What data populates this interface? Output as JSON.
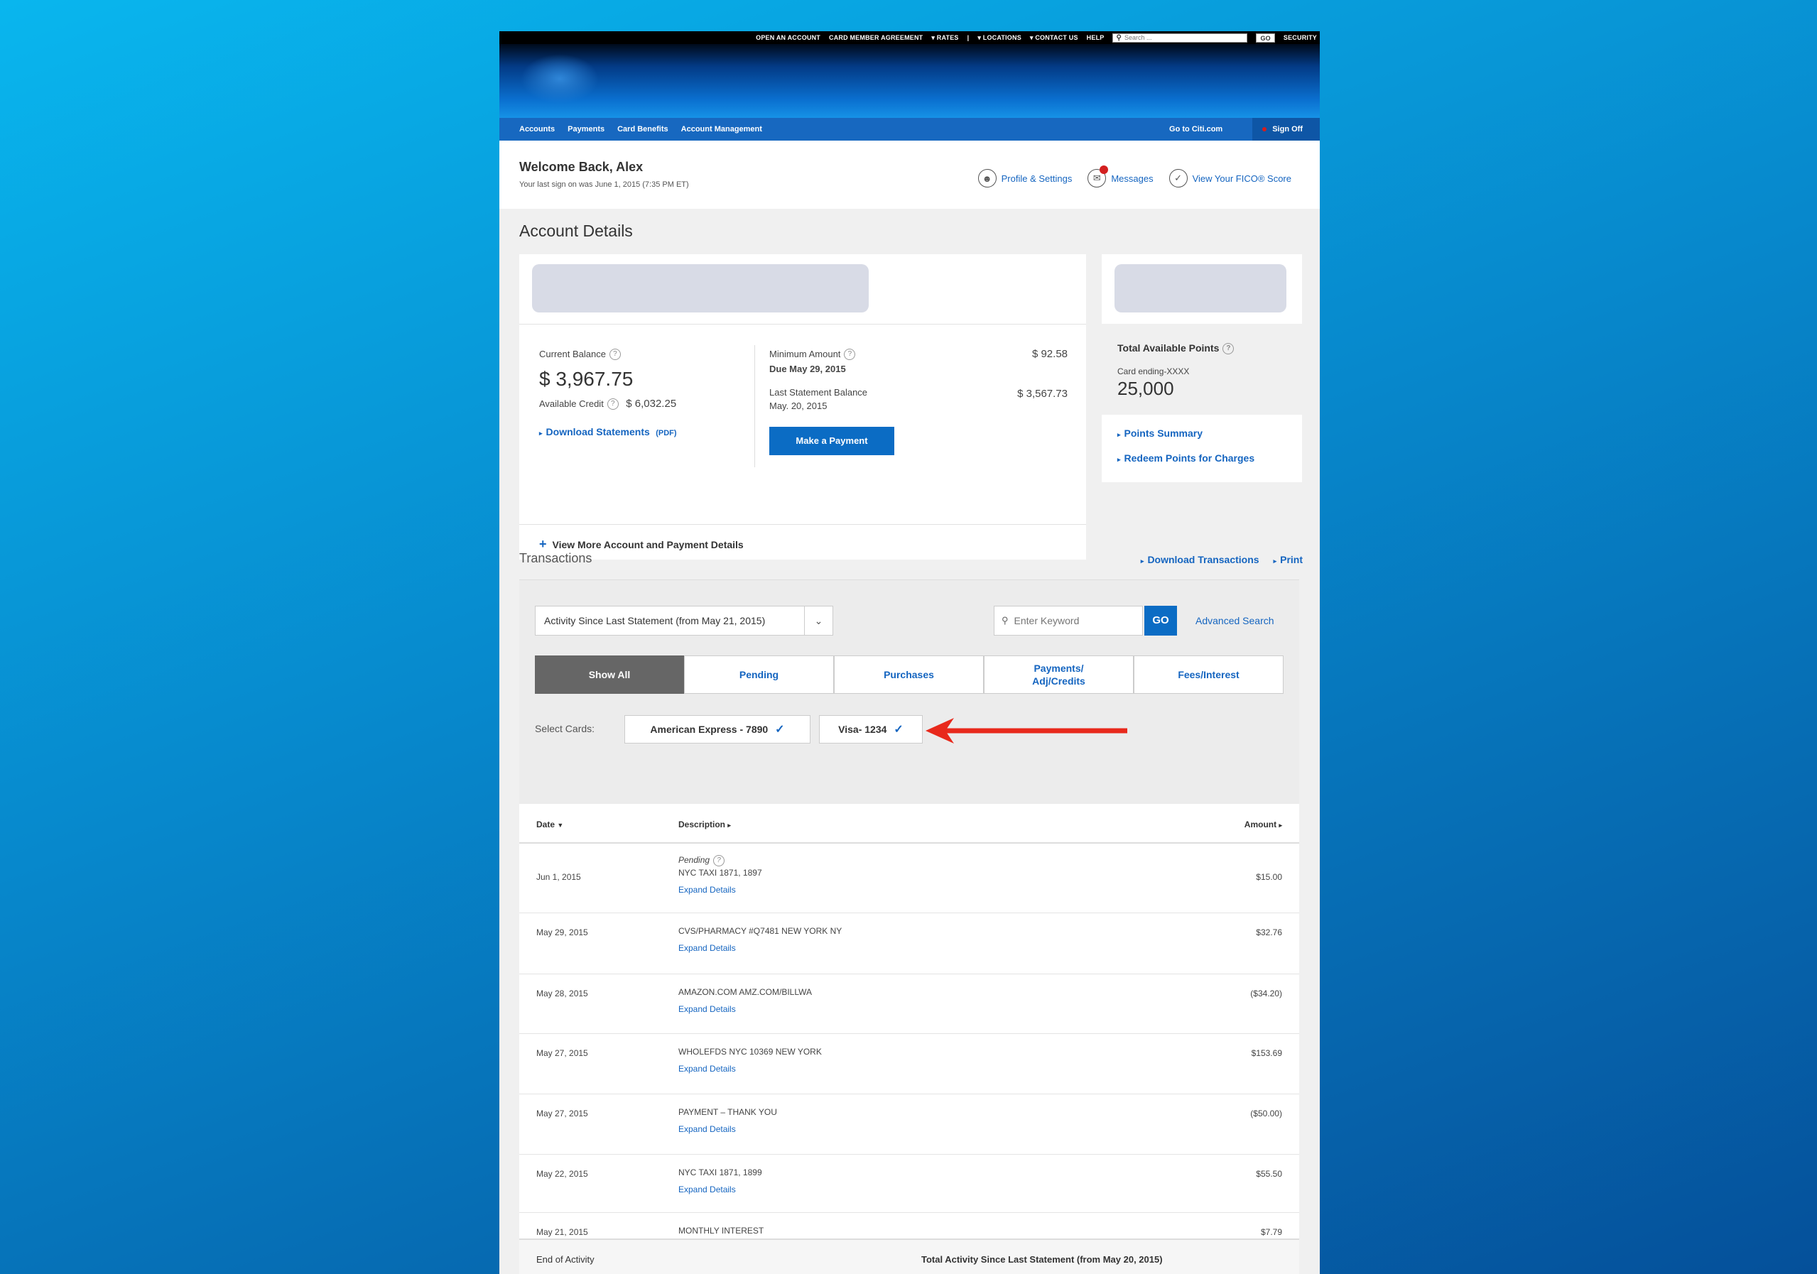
{
  "util_nav": {
    "items": [
      "OPEN AN ACCOUNT",
      "CARD MEMBER AGREEMENT",
      "▾ RATES",
      "|",
      "▾ LOCATIONS",
      "▾ CONTACT US",
      "HELP"
    ],
    "search_placeholder": "Search ...",
    "go": "GO",
    "security": "SECURITY"
  },
  "main_nav": {
    "items": [
      "Accounts",
      "Payments",
      "Card Benefits",
      "Account Management"
    ],
    "go_to": "Go to Citi.com",
    "sign_off": "Sign Off"
  },
  "welcome": {
    "greeting": "Welcome Back, Alex",
    "last_sign_on": "Your last sign on was June 1, 2015 (7:35 PM ET)"
  },
  "quick_links": {
    "profile": "Profile & Settings",
    "messages": "Messages",
    "fico": "View Your FICO® Score"
  },
  "account": {
    "section_title": "Account Details",
    "current_balance_label": "Current Balance",
    "current_balance": "$ 3,967.75",
    "available_credit_label": "Available Credit",
    "available_credit": "$ 6,032.25",
    "download_statements": "Download Statements",
    "pdf": "(PDF)",
    "minimum_amount_label": "Minimum Amount",
    "due_date": "Due May 29, 2015",
    "minimum_amount": "$ 92.58",
    "last_statement_label": "Last Statement Balance",
    "last_statement_date": "May. 20, 2015",
    "last_statement_balance": "$ 3,567.73",
    "make_payment": "Make a Payment",
    "view_more": "View More Account and Payment Details"
  },
  "points": {
    "title": "Total Available Points",
    "card_ending": "Card ending-XXXX",
    "value": "25,000",
    "summary_link": "Points Summary",
    "redeem_link": "Redeem Points for Charges"
  },
  "transactions": {
    "title": "Transactions",
    "download": "Download Transactions",
    "print": "Print",
    "period_select": "Activity Since Last Statement (from May 21, 2015)",
    "keyword_placeholder": "Enter Keyword",
    "go": "GO",
    "advanced_search": "Advanced Search",
    "tabs": [
      "Show All",
      "Pending",
      "Purchases",
      "Payments/\nAdj/Credits",
      "Fees/Interest"
    ],
    "select_cards_label": "Select Cards:",
    "cards": [
      "American Express - 7890",
      "Visa- 1234"
    ],
    "columns": {
      "date": "Date",
      "description": "Description",
      "amount": "Amount"
    },
    "expand_label": "Expand Details",
    "pending_label": "Pending",
    "rows": [
      {
        "date": "Jun 1, 2015",
        "description": "NYC TAXI 1871, 1897",
        "amount": "$15.00"
      },
      {
        "date": "May 29, 2015",
        "description": "CVS/PHARMACY #Q7481 NEW YORK NY",
        "amount": "$32.76"
      },
      {
        "date": "May 28, 2015",
        "description": "AMAZON.COM AMZ.COM/BILLWA",
        "amount": "($34.20)"
      },
      {
        "date": "May 27, 2015",
        "description": "WHOLEFDS NYC 10369 NEW YORK",
        "amount": "$153.69"
      },
      {
        "date": "May 27, 2015",
        "description": "PAYMENT – THANK YOU",
        "amount": "($50.00)"
      },
      {
        "date": "May 22, 2015",
        "description": "NYC TAXI 1871, 1899",
        "amount": "$55.50"
      },
      {
        "date": "May 21, 2015",
        "description": "MONTHLY INTEREST",
        "amount": "$7.79"
      }
    ],
    "end_of_activity": "End of Activity",
    "total_label": "Total Activity Since Last Statement (from May 20, 2015)"
  },
  "colors": {
    "accent": "#1565c0",
    "nav": "#1768c0",
    "arrow": "#e8291c",
    "active_tab": "#666666"
  }
}
